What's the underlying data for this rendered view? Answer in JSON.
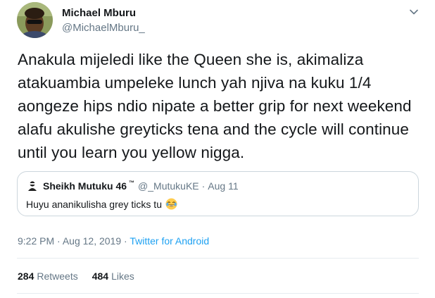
{
  "author": {
    "display_name": "Michael Mburu",
    "handle": "@MichaelMburu_"
  },
  "tweet": {
    "text": "Anakula mijeledi like the Queen she is, akimaliza atakuambia umpeleke lunch yah njiva na kuku 1/4 aongeze hips ndio nipate a better grip for next weekend alafu akulishe greyticks tena and the cycle will continue until you learn you yellow nigga."
  },
  "quoted_tweet": {
    "display_name": "Sheikh Mutuku 46",
    "name_badge": "™",
    "handle": "@_MutukuKE",
    "separator": "·",
    "date": "Aug 11",
    "text": "Huyu ananikulisha grey ticks tu",
    "emoji": "face-with-tears-of-joy"
  },
  "meta": {
    "time": "9:22 PM",
    "date": "Aug 12, 2019",
    "separator": "·",
    "source": "Twitter for Android"
  },
  "stats": {
    "retweets_count": "284",
    "retweets_label": "Retweets",
    "likes_count": "484",
    "likes_label": "Likes"
  },
  "colors": {
    "text": "#14171a",
    "secondary": "#657786",
    "link": "#1da1f2",
    "border": "#ccd6dd"
  },
  "icons": [
    "avatar",
    "chevron-down-icon",
    "quoted-avatar",
    "laughing-emoji-icon"
  ]
}
